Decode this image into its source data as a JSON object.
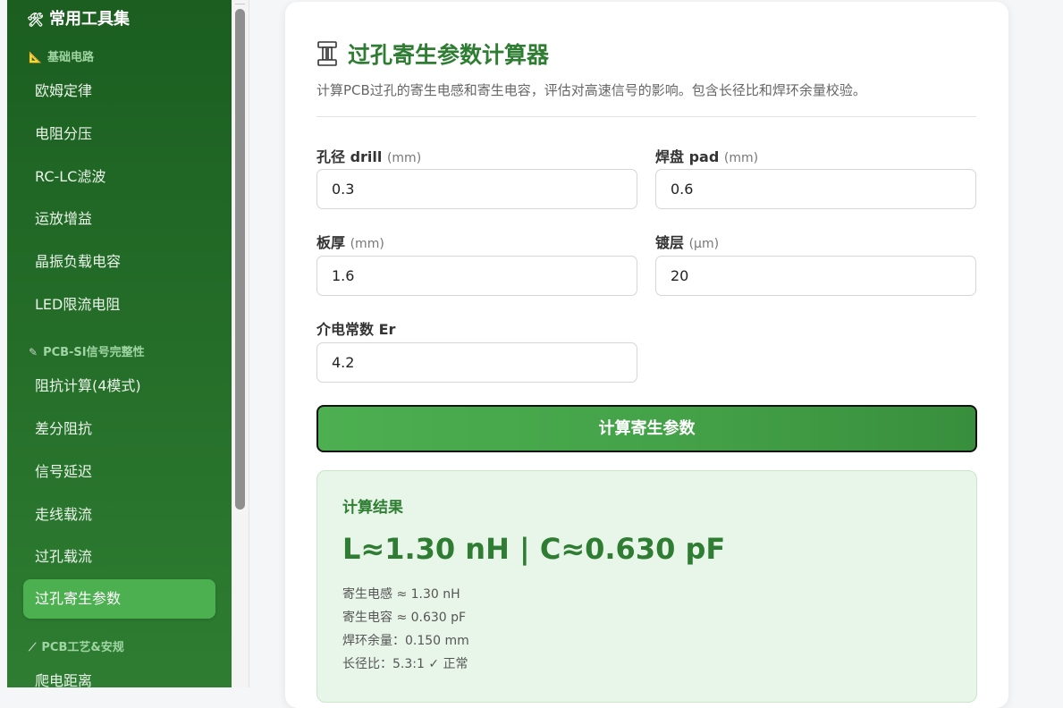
{
  "sidebar": {
    "header": "常用工具集",
    "groups": [
      {
        "label": "基础电路"
      },
      {
        "label": "PCB-SI信号完整性"
      },
      {
        "label": "PCB工艺&安规"
      }
    ],
    "items": [
      {
        "label": "欧姆定律"
      },
      {
        "label": "电阻分压"
      },
      {
        "label": "RC-LC滤波"
      },
      {
        "label": "运放增益"
      },
      {
        "label": "晶振负载电容"
      },
      {
        "label": "LED限流电阻"
      },
      {
        "label": "阻抗计算(4模式)"
      },
      {
        "label": "差分阻抗"
      },
      {
        "label": "信号延迟"
      },
      {
        "label": "走线载流"
      },
      {
        "label": "过孔载流"
      },
      {
        "label": "过孔寄生参数"
      },
      {
        "label": "爬电距离"
      }
    ],
    "active_item": "过孔寄生参数"
  },
  "main": {
    "title": "过孔寄生参数计算器",
    "description": "计算PCB过孔的寄生电感和寄生电容，评估对高速信号的影响。包含长径比和焊环余量校验。",
    "fields": [
      {
        "label": "孔径 drill",
        "unit": "(mm)",
        "value": "0.3"
      },
      {
        "label": "焊盘 pad",
        "unit": "(mm)",
        "value": "0.6"
      },
      {
        "label": "板厚",
        "unit": "(mm)",
        "value": "1.6"
      },
      {
        "label": "镀层",
        "unit": "(μm)",
        "value": "20"
      },
      {
        "label": "介电常数 Er",
        "unit": "",
        "value": "4.2"
      }
    ],
    "button_label": "计算寄生参数",
    "result": {
      "title": "计算结果",
      "main": "L≈1.30 nH | C≈0.630 pF",
      "lines": [
        "寄生电感 ≈ 1.30 nH",
        "寄生电容 ≈ 0.630 pF",
        "焊环余量：0.150 mm",
        "长径比：5.3:1 ✓ 正常"
      ]
    }
  },
  "colors": {
    "sidebar_top": "#1b5e20",
    "sidebar_bottom": "#2e7d32",
    "accent": "#4caf50",
    "title": "#2e7d32",
    "result_bg": "#e8f5e9"
  },
  "icons": {
    "header": "tools-icon",
    "group_basic": "ruler-triangle-icon",
    "group_si": "pencil-icon",
    "group_process": "wrench-icon",
    "title": "via-icon"
  }
}
